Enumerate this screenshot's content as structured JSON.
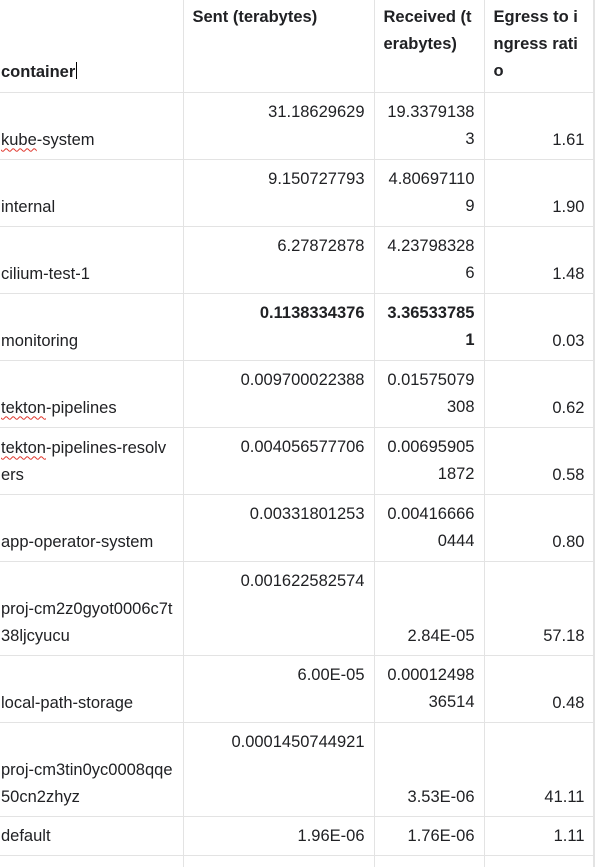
{
  "table": {
    "headers": {
      "container": "container",
      "sent": "Sent (terabytes)",
      "received": "Received (terabytes)",
      "ratio": "Egress to ingress ratio"
    },
    "rows": [
      {
        "name": "kube-system",
        "sent": "31.18629629",
        "received": "19.33791383",
        "ratio": "1.61",
        "spellcheck_word": "kube"
      },
      {
        "name": "internal",
        "sent": "9.150727793",
        "received": "4.806971109",
        "ratio": "1.90"
      },
      {
        "name": "cilium-test-1",
        "sent": "6.27872878",
        "received": "4.237983286",
        "ratio": "1.48"
      },
      {
        "name": "monitoring",
        "sent": "0.1138334376",
        "received": "3.365337851",
        "ratio": "0.03",
        "bold": true
      },
      {
        "name": "tekton-pipelines",
        "sent": "0.009700022388",
        "received": "0.01575079308",
        "ratio": "0.62",
        "spellcheck_word": "tekton"
      },
      {
        "name": "tekton-pipelines-resolvers",
        "sent": "0.004056577706",
        "received": "0.006959051872",
        "ratio": "0.58",
        "spellcheck_word": "tekton"
      },
      {
        "name": "app-operator-system",
        "sent": "0.00331801253",
        "received": "0.004166660444",
        "ratio": "0.80"
      },
      {
        "name": "proj-cm2z0gyot0006c7t38ljcyucu",
        "sent": "0.001622582574",
        "received": "2.84E-05",
        "ratio": "57.18",
        "tall": true
      },
      {
        "name": "local-path-storage",
        "sent": "6.00E-05",
        "received": "0.0001249836514",
        "ratio": "0.48"
      },
      {
        "name": "proj-cm3tin0yc0008qqe50cn2zhyz",
        "sent": "0.0001450744921",
        "received": "3.53E-06",
        "ratio": "41.11",
        "tall": true
      },
      {
        "name": "default",
        "sent": "1.96E-06",
        "received": "1.76E-06",
        "ratio": "1.11",
        "short": true
      }
    ]
  }
}
